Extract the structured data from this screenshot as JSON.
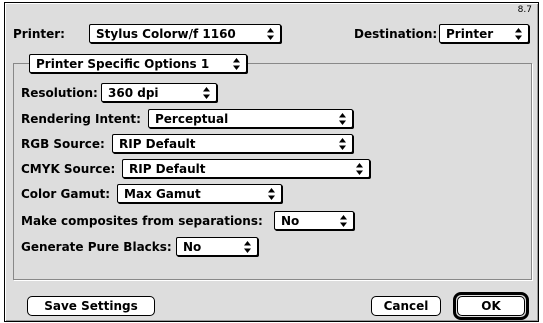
{
  "version": "8.7",
  "printer": {
    "label": "Printer:",
    "value": "Stylus Colorw/f 1160"
  },
  "destination": {
    "label": "Destination:",
    "value": "Printer"
  },
  "panel": {
    "value": "Printer Specific Options 1"
  },
  "fields": {
    "resolution": {
      "label": "Resolution:",
      "value": "360 dpi"
    },
    "rendering_intent": {
      "label": "Rendering Intent:",
      "value": "Perceptual"
    },
    "rgb_source": {
      "label": "RGB Source:",
      "value": "RIP Default"
    },
    "cmyk_source": {
      "label": "CMYK Source:",
      "value": "RIP Default"
    },
    "color_gamut": {
      "label": "Color Gamut:",
      "value": "Max Gamut"
    },
    "make_composites": {
      "label": "Make composites from separations:",
      "value": "No"
    },
    "pure_blacks": {
      "label": "Generate Pure Blacks:",
      "value": "No"
    }
  },
  "buttons": {
    "save_settings": "Save Settings",
    "cancel": "Cancel",
    "ok": "OK"
  },
  "icons": {
    "popup_arrow": "updown-arrows-icon"
  }
}
